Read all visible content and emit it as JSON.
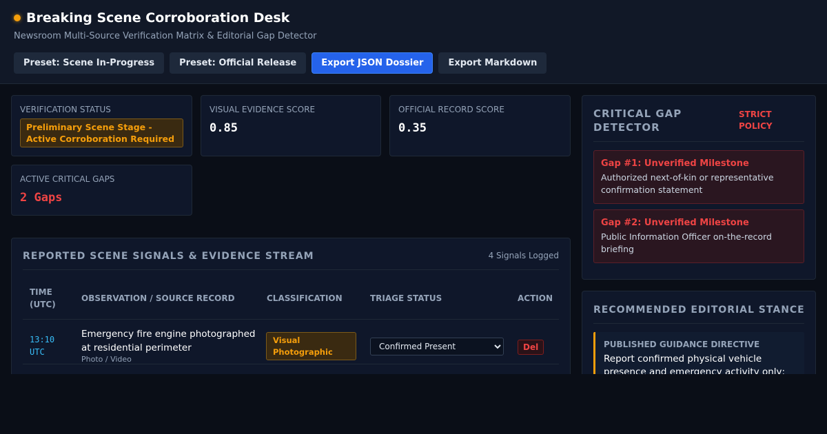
{
  "app": {
    "title": "Breaking Scene Corroboration Desk",
    "subtitle": "Newsroom Multi-Source Verification Matrix & Editorial Gap Detector",
    "status_dot_color": "#f59e0b"
  },
  "toolbar": {
    "buttons": [
      {
        "label": "Preset: Scene In-Progress",
        "primary": false
      },
      {
        "label": "Preset: Official Release",
        "primary": false
      },
      {
        "label": "Export JSON Dossier",
        "primary": true
      },
      {
        "label": "Export Markdown",
        "primary": false
      }
    ]
  },
  "stats": {
    "verification": {
      "label": "VERIFICATION STATUS",
      "value": "Preliminary Scene Stage - Active Corroboration Required"
    },
    "visual": {
      "label": "VISUAL EVIDENCE SCORE",
      "value": "0.85"
    },
    "official": {
      "label": "OFFICIAL RECORD SCORE",
      "value": "0.35"
    },
    "gaps": {
      "label": "ACTIVE CRITICAL GAPS",
      "value": "2 Gaps"
    }
  },
  "signals": {
    "title": "REPORTED SCENE SIGNALS & EVIDENCE STREAM",
    "count": "4 Signals Logged",
    "columns": [
      "TIME (UTC)",
      "OBSERVATION / SOURCE RECORD",
      "CLASSIFICATION",
      "TRIAGE STATUS",
      "ACTION"
    ],
    "rows": [
      {
        "time": "13:10 UTC",
        "observation": "Emergency fire engine photographed at residential perimeter",
        "source": "Photo / Video",
        "classification": "Visual Photographic",
        "triage": "Confirmed Present",
        "action": "Del"
      }
    ]
  },
  "gap_detector": {
    "title": "CRITICAL GAP DETECTOR",
    "policy": "STRICT POLICY",
    "gaps": [
      {
        "title": "Gap #1: Unverified Milestone",
        "description": "Authorized next-of-kin or representative confirmation statement"
      },
      {
        "title": "Gap #2: Unverified Milestone",
        "description": "Public Information Officer on-the-record briefing"
      }
    ]
  },
  "stance": {
    "title": "RECOMMENDED EDITORIAL STANCE",
    "directive_label": "PUBLISHED GUIDANCE DIRECTIVE",
    "directive_text": "Report confirmed physical vehicle presence and emergency activity only;"
  },
  "colors": {
    "background": "#0a0e17",
    "accent": "#2563eb",
    "warning": "#f59e0b",
    "danger": "#ef4444",
    "time": "#38bdf8"
  },
  "icons": [
    "status-dot"
  ]
}
